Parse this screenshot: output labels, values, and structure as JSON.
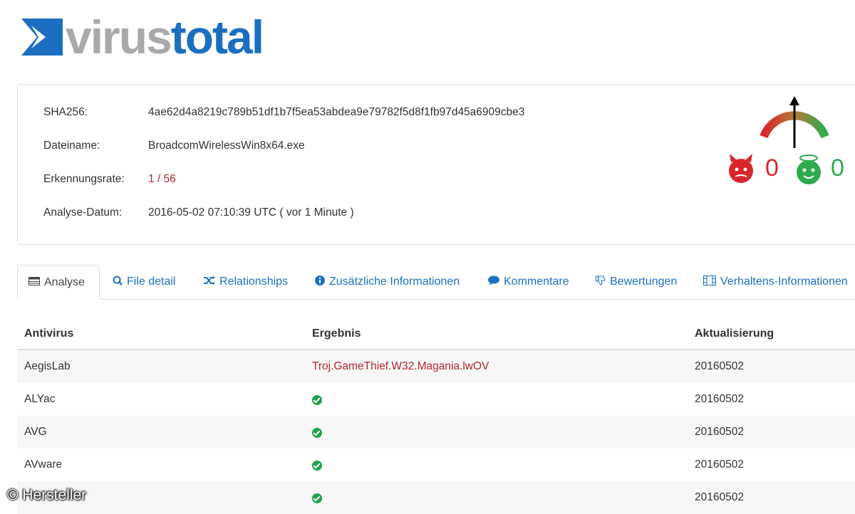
{
  "brand": {
    "logo_part1": "virus",
    "logo_part2": "total"
  },
  "info": {
    "sha_label": "SHA256:",
    "sha_value": "4ae62d4a8219c789b51df1b7f5ea53abdea9e79782f5d8f1fb97d45a6909cbe3",
    "filename_label": "Dateiname:",
    "filename_value": "BroadcomWirelessWin8x64.exe",
    "rate_label": "Erkennungsrate:",
    "rate_value": "1 / 56",
    "date_label": "Analyse-Datum:",
    "date_value": "2016-05-02 07:10:39 UTC ( vor 1 Minute )"
  },
  "votes": {
    "malicious": "0",
    "harmless": "0",
    "colors": {
      "malicious": "#d9262c",
      "harmless": "#2eab4f"
    }
  },
  "tabs": [
    {
      "label": "Analyse",
      "icon": "table-icon"
    },
    {
      "label": "File detail",
      "icon": "search-icon"
    },
    {
      "label": "Relationships",
      "icon": "shuffle-icon"
    },
    {
      "label": "Zusätzliche Informationen",
      "icon": "info-icon"
    },
    {
      "label": "Kommentare",
      "icon": "comment-icon"
    },
    {
      "label": "Bewertungen",
      "icon": "thumbs-down-icon"
    },
    {
      "label": "Verhaltens-Informationen",
      "icon": "film-icon"
    }
  ],
  "table": {
    "headers": [
      "Antivirus",
      "Ergebnis",
      "Aktualisierung"
    ],
    "rows": [
      {
        "antivirus": "AegisLab",
        "result": "Troj.GameThief.W32.Magania.lwOV",
        "clean": false,
        "updated": "20160502"
      },
      {
        "antivirus": "ALYac",
        "result": "",
        "clean": true,
        "updated": "20160502"
      },
      {
        "antivirus": "AVG",
        "result": "",
        "clean": true,
        "updated": "20160502"
      },
      {
        "antivirus": "AVware",
        "result": "",
        "clean": true,
        "updated": "20160502"
      },
      {
        "antivirus": "",
        "result": "",
        "clean": true,
        "updated": "20160502"
      }
    ]
  },
  "watermark": "© Hersteller",
  "colors": {
    "accent": "#1c6fc0",
    "detection": "#b0282c",
    "clean": "#1fa24a"
  }
}
